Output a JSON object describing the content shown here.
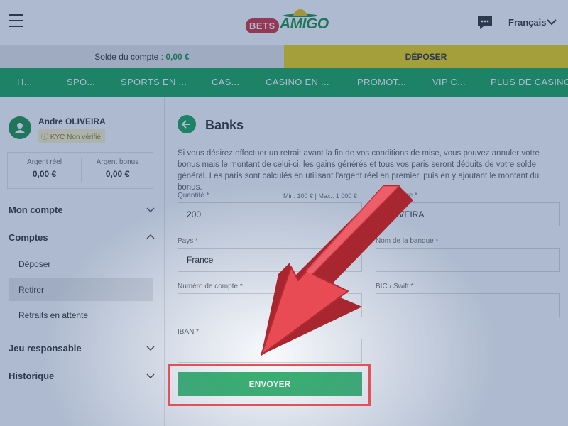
{
  "header": {
    "logo_bets": "BETS",
    "logo_amigo": "AMIGO",
    "language": "Français"
  },
  "balance": {
    "label": "Solde du compte : ",
    "amount": "0,00 €",
    "deposit_label": "DÉPOSER"
  },
  "nav": {
    "items": [
      "H...",
      "SPO...",
      "SPORTS EN ...",
      "CAS...",
      "CASINO EN ...",
      "PROMOT...",
      "VIP C...",
      "PLUS DE CASINC"
    ]
  },
  "user": {
    "name": "Andre OLIVEIRA",
    "kyc": "KYC Non vérifié",
    "real_money_label": "Argent réel",
    "real_money": "0,00 €",
    "bonus_money_label": "Argent bonus",
    "bonus_money": "0,00 €"
  },
  "sidebar": {
    "mon_compte": "Mon compte",
    "comptes": "Comptes",
    "deposer": "Déposer",
    "retirer": "Retirer",
    "retraits": "Retraits en attente",
    "jeu_responsable": "Jeu responsable",
    "historique": "Historique"
  },
  "form": {
    "title": "Banks",
    "info": "Si vous désirez effectuer un retrait avant la fin de vos conditions de mise, vous pouvez annuler votre bonus mais le montant de celui-ci, les gains générés et tous vos paris seront déduits de votre solde général. Les paris sont calculés en utilisant l'argent réel en premier, puis en y ajoutant le montant du bonus.",
    "quantity_label": "Quantité *",
    "quantity_hint": "Min: 100 € | Max:: 1 000 €",
    "quantity_value": "200",
    "beneficiary_label": "Bénéficiaire *",
    "beneficiary_value": "OLIVEIRA",
    "country_label": "Pays *",
    "country_value": "France",
    "bank_name_label": "Nom de la banque *",
    "account_label": "Numéro de compte *",
    "bic_label": "BIC / Swift *",
    "iban_label": "IBAN *",
    "submit": "ENVOYER"
  },
  "colors": {
    "brand_green": "#07a04a",
    "deposit_yellow": "#f0d000",
    "highlight_red": "#e4505a"
  }
}
